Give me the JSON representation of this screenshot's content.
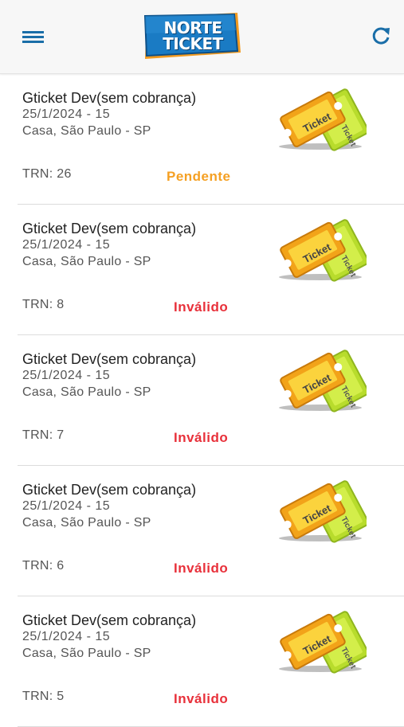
{
  "header": {
    "logo_line1": "NORTE",
    "logo_line2": "TICKET",
    "menu_icon": "hamburger-menu-icon",
    "refresh_icon": "refresh-icon"
  },
  "colors": {
    "pending": "#f5a023",
    "invalid": "#e8303a",
    "brand_blue": "#1a7bc4",
    "icon_blue": "#1a6ea8"
  },
  "tickets": [
    {
      "title": "Gticket Dev(sem cobrança)",
      "date": "25/1/2024 - 15",
      "location": "Casa, São Paulo - SP",
      "trn": "TRN: 26",
      "status": "Pendente",
      "status_type": "pending"
    },
    {
      "title": "Gticket Dev(sem cobrança)",
      "date": "25/1/2024 - 15",
      "location": "Casa, São Paulo - SP",
      "trn": "TRN: 8",
      "status": "Inválido",
      "status_type": "invalid"
    },
    {
      "title": "Gticket Dev(sem cobrança)",
      "date": "25/1/2024 - 15",
      "location": "Casa, São Paulo - SP",
      "trn": "TRN: 7",
      "status": "Inválido",
      "status_type": "invalid"
    },
    {
      "title": "Gticket Dev(sem cobrança)",
      "date": "25/1/2024 - 15",
      "location": "Casa, São Paulo - SP",
      "trn": "TRN: 6",
      "status": "Inválido",
      "status_type": "invalid"
    },
    {
      "title": "Gticket Dev(sem cobrança)",
      "date": "25/1/2024 - 15",
      "location": "Casa, São Paulo - SP",
      "trn": "TRN: 5",
      "status": "Inválido",
      "status_type": "invalid"
    }
  ],
  "ticket_image_labels": {
    "front": "Ticket",
    "back": "Ticket"
  }
}
